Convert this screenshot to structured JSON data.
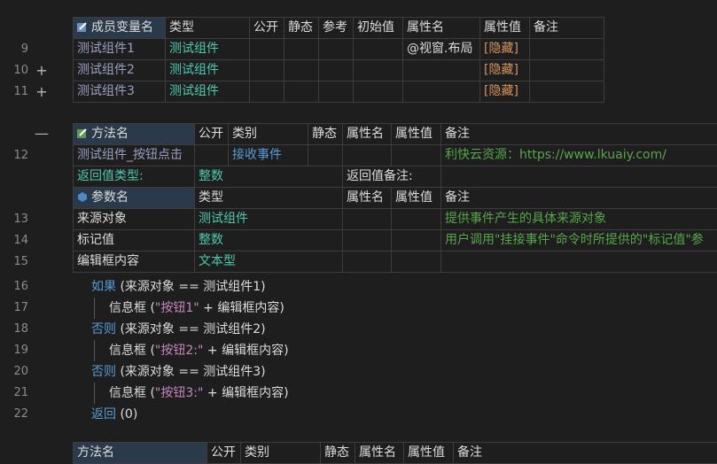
{
  "member_table": {
    "headers": [
      "成员变量名",
      "类型",
      "公开",
      "静态",
      "参考",
      "初始值",
      "属性名",
      "属性值",
      "备注"
    ],
    "rows": [
      {
        "line": "9",
        "fold": "",
        "name": "测试组件1",
        "type": "测试组件",
        "attr": "@视窗.布局",
        "value": "[隐藏]"
      },
      {
        "line": "10",
        "fold": "+",
        "name": "测试组件2",
        "type": "测试组件",
        "attr": "",
        "value": "[隐藏]"
      },
      {
        "line": "11",
        "fold": "+",
        "name": "测试组件3",
        "type": "测试组件",
        "attr": "",
        "value": "[隐藏]"
      }
    ]
  },
  "method_table": {
    "fold": "—",
    "headers": [
      "方法名",
      "公开",
      "类别",
      "静态",
      "属性名",
      "属性值",
      "备注"
    ],
    "row": {
      "line": "12",
      "name": "测试组件_按钮点击",
      "category": "接收事件",
      "note": "利快云资源：https://www.lkuaiy.com/"
    },
    "return_type_label": "返回值类型:",
    "return_type": "整数",
    "return_note_label": "返回值备注:",
    "param_headers": [
      "参数名",
      "类型",
      "属性名",
      "属性值",
      "备注"
    ],
    "params": [
      {
        "line": "13",
        "name": "来源对象",
        "type": "测试组件",
        "note": "提供事件产生的具体来源对象"
      },
      {
        "line": "14",
        "name": "标记值",
        "type": "整数",
        "note": "用户调用\"挂接事件\"命令时所提供的\"标记值\"参"
      },
      {
        "line": "15",
        "name": "编辑框内容",
        "type": "文本型",
        "note": ""
      }
    ]
  },
  "code": [
    {
      "line": "16",
      "indent": 0,
      "kw": "如果",
      "rest": " (来源对象 == 测试组件1)"
    },
    {
      "line": "17",
      "indent": 1,
      "fn": "信息框",
      "open": " (",
      "str": "\"按钮1\"",
      "op": " + ",
      "tail": "编辑框内容)"
    },
    {
      "line": "18",
      "indent": 0,
      "kw": "否则",
      "rest": " (来源对象 == 测试组件2)"
    },
    {
      "line": "19",
      "indent": 1,
      "fn": "信息框",
      "open": " (",
      "str": "\"按钮2:\"",
      "op": " + ",
      "tail": "编辑框内容)"
    },
    {
      "line": "20",
      "indent": 0,
      "kw": "否则",
      "rest": " (来源对象 == 测试组件3)"
    },
    {
      "line": "21",
      "indent": 1,
      "fn": "信息框",
      "open": " (",
      "str": "\"按钮3:\"",
      "op": " + ",
      "tail": "编辑框内容)"
    },
    {
      "line": "22",
      "indent": 0,
      "kw": "返回",
      "rest": " (0)"
    }
  ],
  "next_table_headers": [
    "方法名",
    "公开",
    "类别",
    "静态",
    "属性名",
    "属性值",
    "备注"
  ],
  "colors": {
    "background": "#1e1e1e",
    "type": "#4ec9b0",
    "hidden": "#d7955e",
    "note": "#57a64a",
    "keyword": "#569cd6",
    "string": "#c586c0"
  },
  "icons": {
    "member": "member-variable-icon",
    "method": "method-icon",
    "param": "parameter-icon"
  }
}
